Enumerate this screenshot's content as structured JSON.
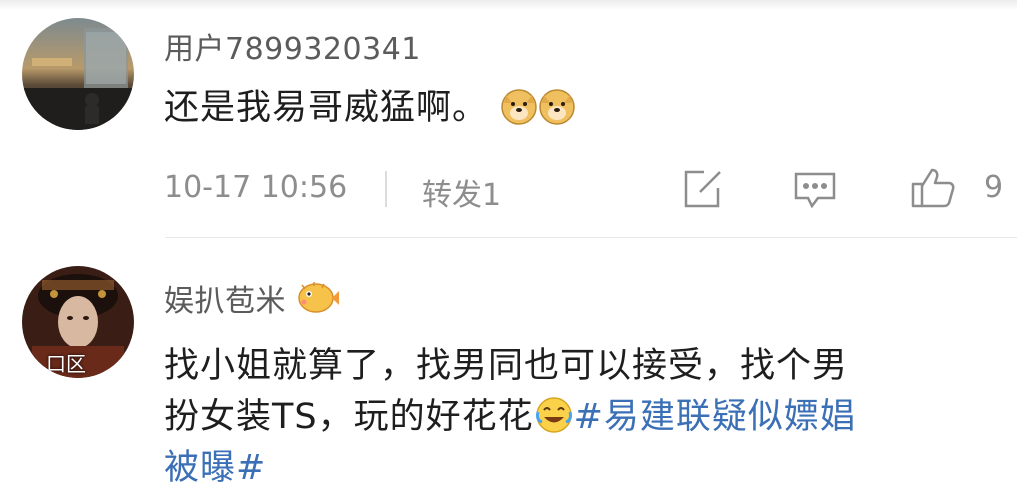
{
  "comments": [
    {
      "username": "用户7899320341",
      "text": "还是我易哥威猛啊。",
      "emojis": [
        "doge-emoji",
        "doge-emoji"
      ],
      "timestamp": "10-17 10:56",
      "repost_label": "转发1",
      "like_count": "9",
      "icons": [
        "repost-icon",
        "comment-icon",
        "like-icon"
      ]
    },
    {
      "username": "娱扒苞米",
      "username_badge": "blowfish-emoji",
      "avatar_watermark": "口区",
      "lines": [
        "找小姐就算了，找男同也可以接受，找个男",
        "扮女装TS，玩的好花花"
      ],
      "hashtag_line1": "#易建联疑似嫖娼",
      "hashtag_line2": "被曝",
      "hashtag_end": "#",
      "emoji_after_text": "laugh-cry-emoji"
    }
  ],
  "colors": {
    "username": "#5b5b5b",
    "text": "#1e1e1e",
    "meta": "#8d8d8d",
    "hashtag": "#3b6fb6",
    "divider": "#e8e8e8"
  }
}
